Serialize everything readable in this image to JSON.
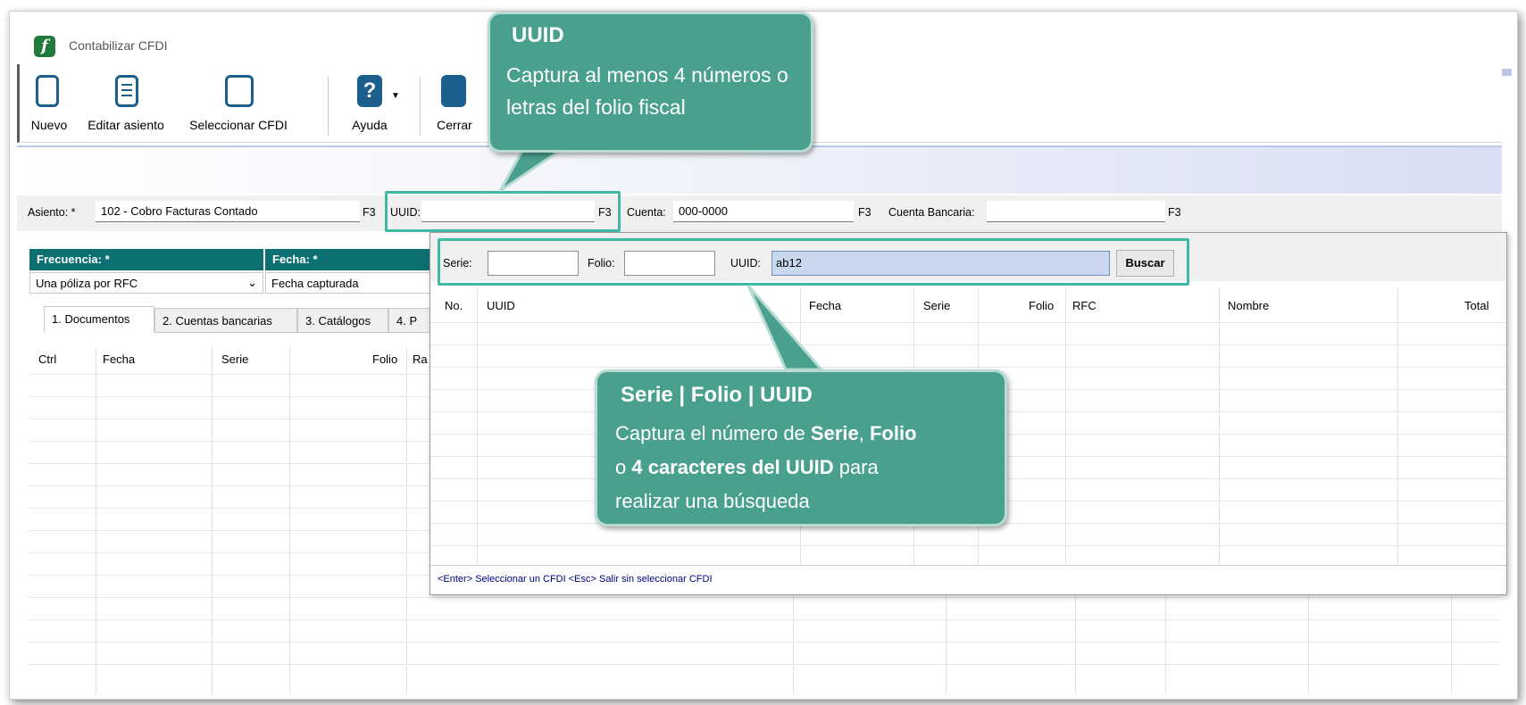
{
  "window": {
    "title": "Contabilizar CFDI",
    "app_icon": "f"
  },
  "toolbar": {
    "nuevo": "Nuevo",
    "editar": "Editar asiento",
    "seleccionar": "Seleccionar CFDI",
    "ayuda": "Ayuda",
    "cerrar": "Cerrar"
  },
  "fields": {
    "asiento_label": "Asiento: *",
    "asiento_value": "102 - Cobro Facturas Contado",
    "f3": "F3",
    "uuid_label": "UUID:",
    "uuid_value": "",
    "cuenta_label": "Cuenta:",
    "cuenta_value": "000-0000",
    "cuenta_bancaria_label": "Cuenta Bancaria:",
    "cuenta_bancaria_value": ""
  },
  "left": {
    "frecuencia_label": "Frecuencia: *",
    "frecuencia_value": "Una póliza por RFC",
    "fecha_label": "Fecha: *",
    "fecha_value": "Fecha capturada",
    "tabs": [
      "1. Documentos",
      "2. Cuentas bancarias",
      "3. Catálogos",
      "4. P"
    ],
    "columns": [
      "Ctrl",
      "Fecha",
      "Serie",
      "Folio",
      "Ra"
    ]
  },
  "search": {
    "serie_label": "Serie:",
    "serie_value": "",
    "folio_label": "Folio:",
    "folio_value": "",
    "uuid_label": "UUID:",
    "uuid_value": "ab12",
    "buscar": "Buscar",
    "columns": [
      "No.",
      "UUID",
      "Fecha",
      "Serie",
      "Folio",
      "RFC",
      "Nombre",
      "Total"
    ],
    "status": "<Enter> Seleccionar un CFDI <Esc> Salir sin seleccionar CFDI"
  },
  "callouts": {
    "uuid_title": "UUID",
    "uuid_text": "Captura al menos 4 números o letras del folio fiscal",
    "serie_title": "Serie | Folio | UUID",
    "serie_t1": "Captura el número de ",
    "serie_b1": "Serie",
    "serie_t2": ", ",
    "serie_b2": "Folio",
    "serie_t3": "o ",
    "serie_b3": "4 caracteres del UUID",
    "serie_t4": " para",
    "serie_t5": "realizar una búsqueda"
  },
  "colors": {
    "teal": "#0c7072",
    "callout": "#4aa08f",
    "highlight": "#3fb9a4",
    "icon_blue": "#1b5f8f"
  }
}
